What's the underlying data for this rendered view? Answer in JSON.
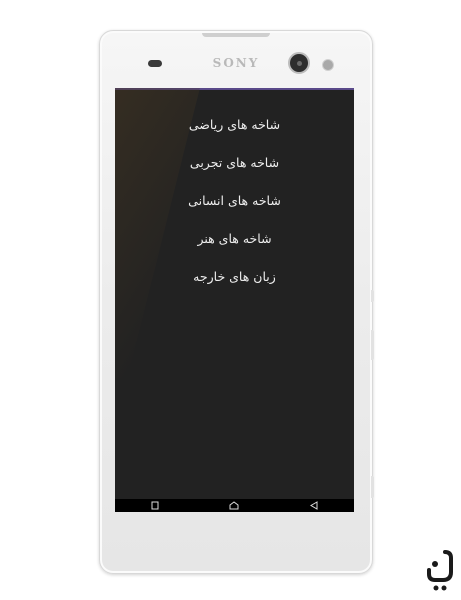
{
  "device": {
    "brand": "SONY"
  },
  "menu": {
    "items": [
      {
        "label": "شاخه های ریاضی"
      },
      {
        "label": "شاخه های تجربی"
      },
      {
        "label": "شاخه های انسانی"
      },
      {
        "label": "شاخه های هنر"
      },
      {
        "label": "زبان های خارجه"
      }
    ]
  },
  "navbar": {
    "icons": [
      "back-icon",
      "home-icon",
      "recents-icon"
    ]
  },
  "watermark": {
    "icon": "store-logo-icon"
  },
  "colors": {
    "screen_background": "#222222",
    "menu_text": "#eeeeee",
    "status_accent": "#5a4a8a",
    "device_body": "#ececec"
  }
}
